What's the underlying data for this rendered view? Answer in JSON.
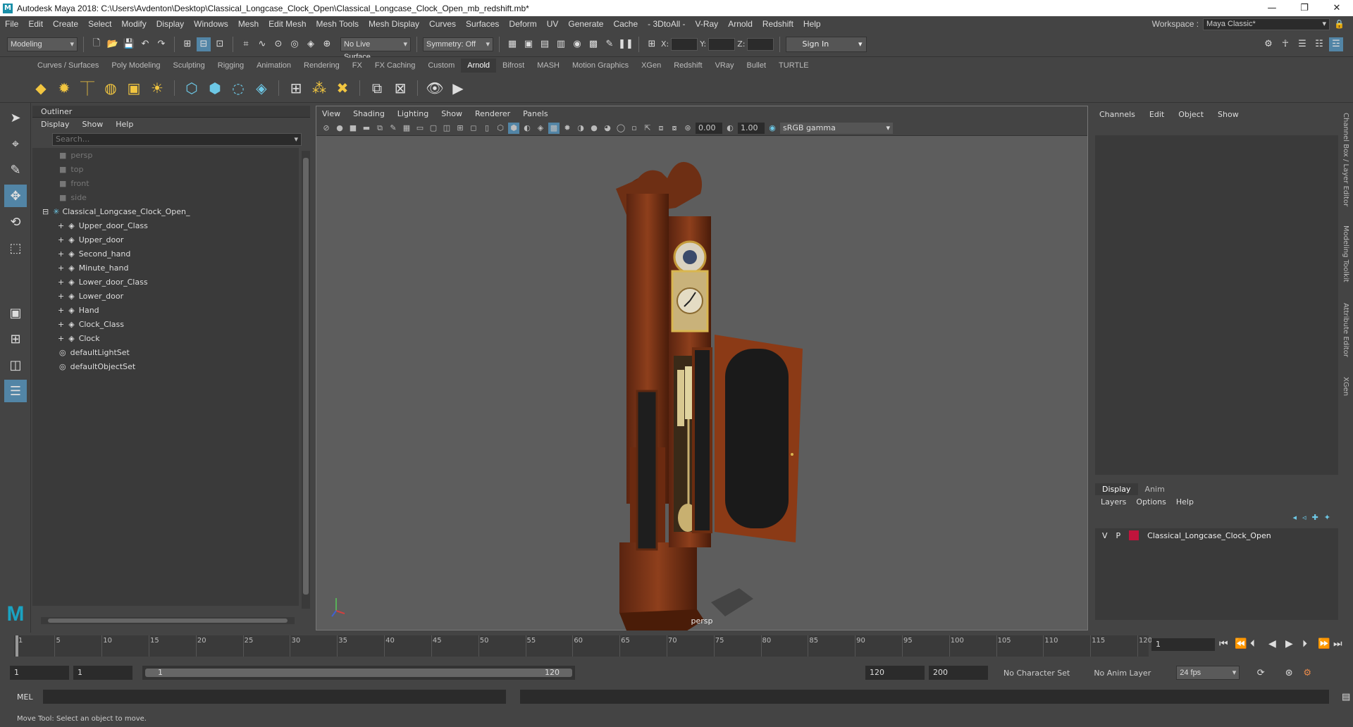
{
  "window": {
    "title": "Autodesk Maya 2018: C:\\Users\\Avdenton\\Desktop\\Classical_Longcase_Clock_Open\\Classical_Longcase_Clock_Open_mb_redshift.mb*",
    "min": "—",
    "max": "❐",
    "close": "✕"
  },
  "menus": [
    "File",
    "Edit",
    "Create",
    "Select",
    "Modify",
    "Display",
    "Windows",
    "Mesh",
    "Edit Mesh",
    "Mesh Tools",
    "Mesh Display",
    "Curves",
    "Surfaces",
    "Deform",
    "UV",
    "Generate",
    "Cache",
    "- 3DtoAll -",
    "V-Ray",
    "Arnold",
    "Redshift",
    "Help"
  ],
  "workspace": {
    "label": "Workspace :",
    "value": "Maya Classic*"
  },
  "status": {
    "mode": "Modeling",
    "live_surface": "No Live Surface",
    "symmetry": "Symmetry: Off",
    "x": "X:",
    "y": "Y:",
    "z": "Z:",
    "sign_in": "Sign In"
  },
  "shelf_tabs": [
    "Curves / Surfaces",
    "Poly Modeling",
    "Sculpting",
    "Rigging",
    "Animation",
    "Rendering",
    "FX",
    "FX Caching",
    "Custom",
    "Arnold",
    "Bifrost",
    "MASH",
    "Motion Graphics",
    "XGen",
    "Redshift",
    "VRay",
    "Bullet",
    "TURTLE"
  ],
  "active_shelf": "Arnold",
  "outliner": {
    "title": "Outliner",
    "menu": [
      "Display",
      "Show",
      "Help"
    ],
    "search_placeholder": "Search...",
    "cameras": [
      "persp",
      "top",
      "front",
      "side"
    ],
    "root": "Classical_Longcase_Clock_Open_",
    "children": [
      "Upper_door_Class",
      "Upper_door",
      "Second_hand",
      "Minute_hand",
      "Lower_door_Class",
      "Lower_door",
      "Hand",
      "Clock_Class",
      "Clock"
    ],
    "sets": [
      "defaultLightSet",
      "defaultObjectSet"
    ]
  },
  "viewport": {
    "menu": [
      "View",
      "Shading",
      "Lighting",
      "Show",
      "Renderer",
      "Panels"
    ],
    "exposure": "0.00",
    "gamma_val": "1.00",
    "colorspace": "sRGB gamma",
    "camera": "persp"
  },
  "channel_box": {
    "menu": [
      "Channels",
      "Edit",
      "Object",
      "Show"
    ]
  },
  "layer_editor": {
    "tabs": [
      "Display",
      "Anim"
    ],
    "menu": [
      "Layers",
      "Options",
      "Help"
    ],
    "layer": {
      "v": "V",
      "p": "P",
      "name": "Classical_Longcase_Clock_Open",
      "color": "#c0143c"
    }
  },
  "side_tabs": [
    "Channel Box / Layer Editor",
    "Modeling Toolkit",
    "Attribute Editor",
    "XGen"
  ],
  "timeline": {
    "ticks": [
      "1",
      "5",
      "10",
      "15",
      "20",
      "25",
      "30",
      "35",
      "40",
      "45",
      "50",
      "55",
      "60",
      "65",
      "70",
      "75",
      "80",
      "85",
      "90",
      "95",
      "100",
      "105",
      "110",
      "115",
      "120"
    ],
    "current": "1"
  },
  "range": {
    "start": "1",
    "anim_start": "1",
    "slider_start": "1",
    "slider_end": "120",
    "end": "120",
    "anim_end": "200",
    "char_set": "No Character Set",
    "anim_layer": "No Anim Layer",
    "fps": "24 fps"
  },
  "mel": {
    "label": "MEL"
  },
  "help": "Move Tool: Select an object to move."
}
